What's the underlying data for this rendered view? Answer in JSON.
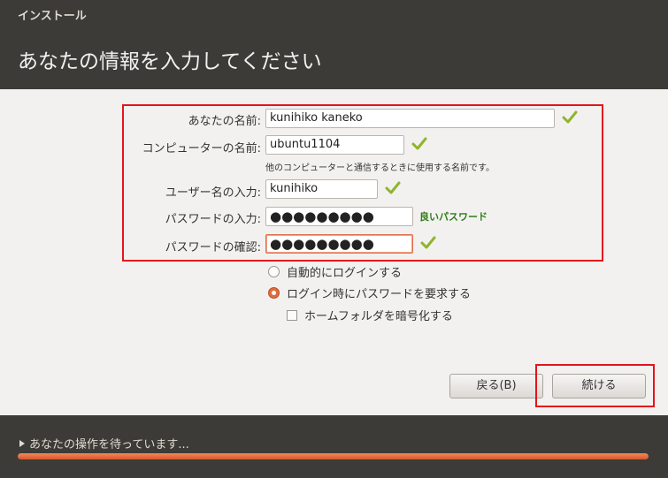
{
  "window": {
    "title": "インストール"
  },
  "page": {
    "heading": "あなたの情報を入力してください"
  },
  "form": {
    "name": {
      "label": "あなたの名前:",
      "value": "kunihiko kaneko"
    },
    "computer": {
      "label": "コンピューターの名前:",
      "value": "ubuntu1104",
      "hint": "他のコンピューターと通信するときに使用する名前です。"
    },
    "username": {
      "label": "ユーザー名の入力:",
      "value": "kunihiko"
    },
    "password": {
      "label": "パスワードの入力:",
      "value": "●●●●●●●●●",
      "strength": "良いパスワード"
    },
    "confirm": {
      "label": "パスワードの確認:",
      "value": "●●●●●●●●●"
    }
  },
  "options": {
    "auto_login": {
      "label": "自動的にログインする",
      "selected": false
    },
    "require_password": {
      "label": "ログイン時にパスワードを要求する",
      "selected": true
    },
    "encrypt_home": {
      "label": "ホームフォルダを暗号化する",
      "checked": false
    }
  },
  "buttons": {
    "back": "戻る(B)",
    "continue": "続ける"
  },
  "footer": {
    "status": "あなたの操作を待っています..."
  },
  "progress": {
    "fraction": 1.0
  },
  "colors": {
    "accent": "#e06b3c",
    "check": "#8fb52a",
    "highlight": "#e5141b",
    "strength": "#2f7d1a"
  }
}
